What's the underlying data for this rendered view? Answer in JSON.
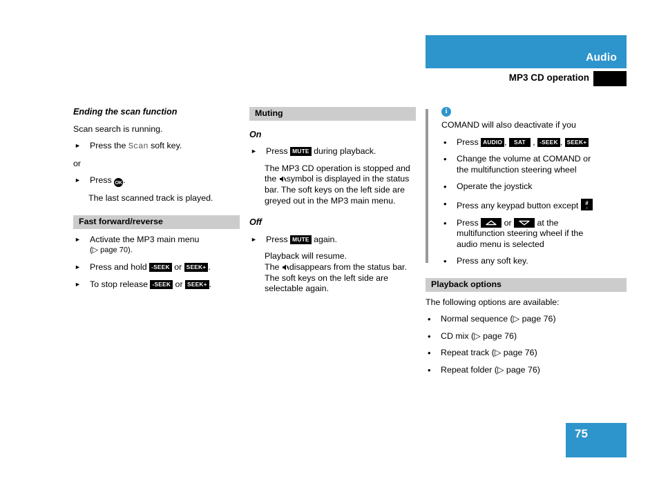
{
  "header": {
    "section_title": "Audio",
    "page_title": "MP3 CD operation"
  },
  "page_number": "75",
  "colors": {
    "brand_blue": "#2e94cc",
    "section_head_gray": "#cccccc",
    "note_rule_gray": "#999999",
    "key_black": "#000000"
  },
  "left_column": {
    "scan": {
      "heading": "Ending the scan function",
      "intro": "Scan search is running.",
      "step1_pre": "Press the",
      "step1_key": "Scan",
      "step1_post": "soft key.",
      "or": "or",
      "step2_pre": "Press",
      "step2_key": "OK",
      "step2_post": ".",
      "result": "The last scanned track is played."
    },
    "fast_forward": {
      "heading": "Fast forward/reverse",
      "step1": "Activate the MP3 main menu",
      "step1_ref": "(▷ page 70).",
      "step2_pre": "Press and hold",
      "step2_key1": "-SEEK",
      "step2_mid": "or",
      "step2_key2": "SEEK+",
      "step2_post": ".",
      "step3_pre": "To stop release",
      "step3_key1": "-SEEK",
      "step3_mid": "or",
      "step3_key2": "SEEK+",
      "step3_post": "."
    }
  },
  "middle_column": {
    "muting": {
      "heading": "Muting",
      "on_label": "On",
      "on_step_pre": "Press",
      "on_step_key": "MUTE",
      "on_step_post": "during playback.",
      "on_result_1": "The MP3 CD operation is stopped and",
      "on_result_2_pre": "the",
      "on_result_2_post": "symbol is displayed in the status",
      "on_result_3": "bar. The soft keys on the left side are",
      "on_result_4": "greyed out in the MP3 main menu.",
      "off_label": "Off",
      "off_step_pre": "Press",
      "off_step_key": "MUTE",
      "off_step_post": "again.",
      "off_result_1": "Playback will resume.",
      "off_result_2_pre": "The",
      "off_result_2_post": "disappears from the status bar.",
      "off_result_3": "The soft keys on the left side are",
      "off_result_4": "selectable again."
    }
  },
  "right_column": {
    "note": {
      "intro": "COMAND will also deactivate if you",
      "items": [
        {
          "pre": "Press",
          "keys": [
            "AUDIO",
            "SAT",
            "-SEEK",
            "SEEK+"
          ],
          "post": ""
        },
        {
          "text_1": "Change the volume at COMAND or",
          "text_2": "the multifunction steering wheel"
        },
        {
          "text_1": "Operate the joystick"
        },
        {
          "pre": "Press any keypad button except",
          "icon": "hash-keypad-icon"
        },
        {
          "pre": "Press",
          "mid": "or",
          "post": "at the",
          "text_2": "multifunction steering wheel if the",
          "text_3": "audio menu is selected"
        },
        {
          "text_1": "Press any soft key."
        }
      ]
    },
    "playback": {
      "heading": "Playback options",
      "intro": "The following options are available:",
      "options": [
        "Normal sequence (▷ page 76)",
        "CD mix (▷ page 76)",
        "Repeat track (▷ page 76)",
        "Repeat folder (▷ page 76)"
      ]
    }
  }
}
